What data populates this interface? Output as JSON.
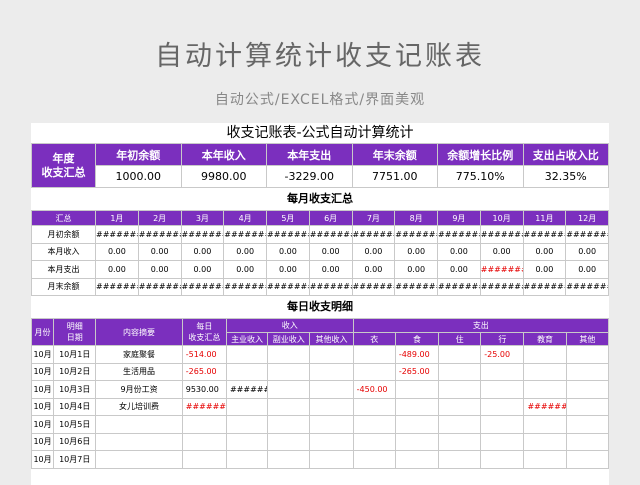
{
  "hero": {
    "title": "自动计算统计收支记账表",
    "subtitle": "自动公式/EXCEL格式/界面美观"
  },
  "sheet_title": "收支记账表-公式自动计算统计",
  "summary": {
    "label_line1": "年度",
    "label_line2": "收支汇总",
    "headers": [
      "年初余额",
      "本年收入",
      "本年支出",
      "年末余额",
      "余额增长比例",
      "支出占收入比"
    ],
    "values": [
      "1000.00",
      "9980.00",
      "-3229.00",
      "7751.00",
      "775.10%",
      "32.35%"
    ]
  },
  "monthly": {
    "title": "每月收支汇总",
    "headers": [
      "汇总",
      "1月",
      "2月",
      "3月",
      "4月",
      "5月",
      "6月",
      "7月",
      "8月",
      "9月",
      "10月",
      "11月",
      "12月"
    ],
    "rows": [
      [
        "月初余额",
        "########",
        "########",
        "########",
        "########",
        "########",
        "########",
        "########",
        "########",
        "########",
        "########",
        "########",
        "########"
      ],
      [
        "本月收入",
        "0.00",
        "0.00",
        "0.00",
        "0.00",
        "0.00",
        "0.00",
        "0.00",
        "0.00",
        "0.00",
        "0.00",
        "0.00",
        "0.00"
      ],
      [
        "本月支出",
        "0.00",
        "0.00",
        "0.00",
        "0.00",
        "0.00",
        "0.00",
        "0.00",
        "0.00",
        "0.00",
        "########",
        "0.00",
        "0.00"
      ],
      [
        "月末余额",
        "########",
        "########",
        "########",
        "########",
        "########",
        "########",
        "########",
        "########",
        "########",
        "########",
        "########",
        "########"
      ]
    ]
  },
  "daily": {
    "title": "每日收支明细",
    "headers": {
      "month": "月份",
      "date_line1": "明细",
      "date_line2": "日期",
      "summary": "内容摘要",
      "daily_line1": "每日",
      "daily_line2": "收支汇总",
      "income": "收入",
      "expense": "支出",
      "income_sub": [
        "主业收入",
        "副业收入",
        "其他收入"
      ],
      "expense_sub": [
        "衣",
        "食",
        "住",
        "行",
        "教育",
        "其他"
      ]
    },
    "rows": [
      [
        "10月",
        "10月1日",
        "家庭聚餐",
        "-514.00",
        "",
        "",
        "",
        "",
        "-489.00",
        "",
        "-25.00",
        "",
        ""
      ],
      [
        "10月",
        "10月2日",
        "生活用品",
        "-265.00",
        "",
        "",
        "",
        "",
        "-265.00",
        "",
        "",
        "",
        ""
      ],
      [
        "10月",
        "10月3日",
        "9月份工资",
        "9530.00",
        "########",
        "",
        "",
        "-450.00",
        "",
        "",
        "",
        "",
        ""
      ],
      [
        "10月",
        "10月4日",
        "女儿培训费",
        "########",
        "",
        "",
        "",
        "",
        "",
        "",
        "",
        "########",
        ""
      ],
      [
        "10月",
        "10月5日",
        "",
        "",
        "",
        "",
        "",
        "",
        "",
        "",
        "",
        "",
        ""
      ],
      [
        "10月",
        "10月6日",
        "",
        "",
        "",
        "",
        "",
        "",
        "",
        "",
        "",
        "",
        ""
      ],
      [
        "10月",
        "10月7日",
        "",
        "",
        "",
        "",
        "",
        "",
        "",
        "",
        "",
        "",
        ""
      ]
    ]
  },
  "colors": {
    "header_purple": "#7b2fbe",
    "negative_red": "#e60000"
  }
}
